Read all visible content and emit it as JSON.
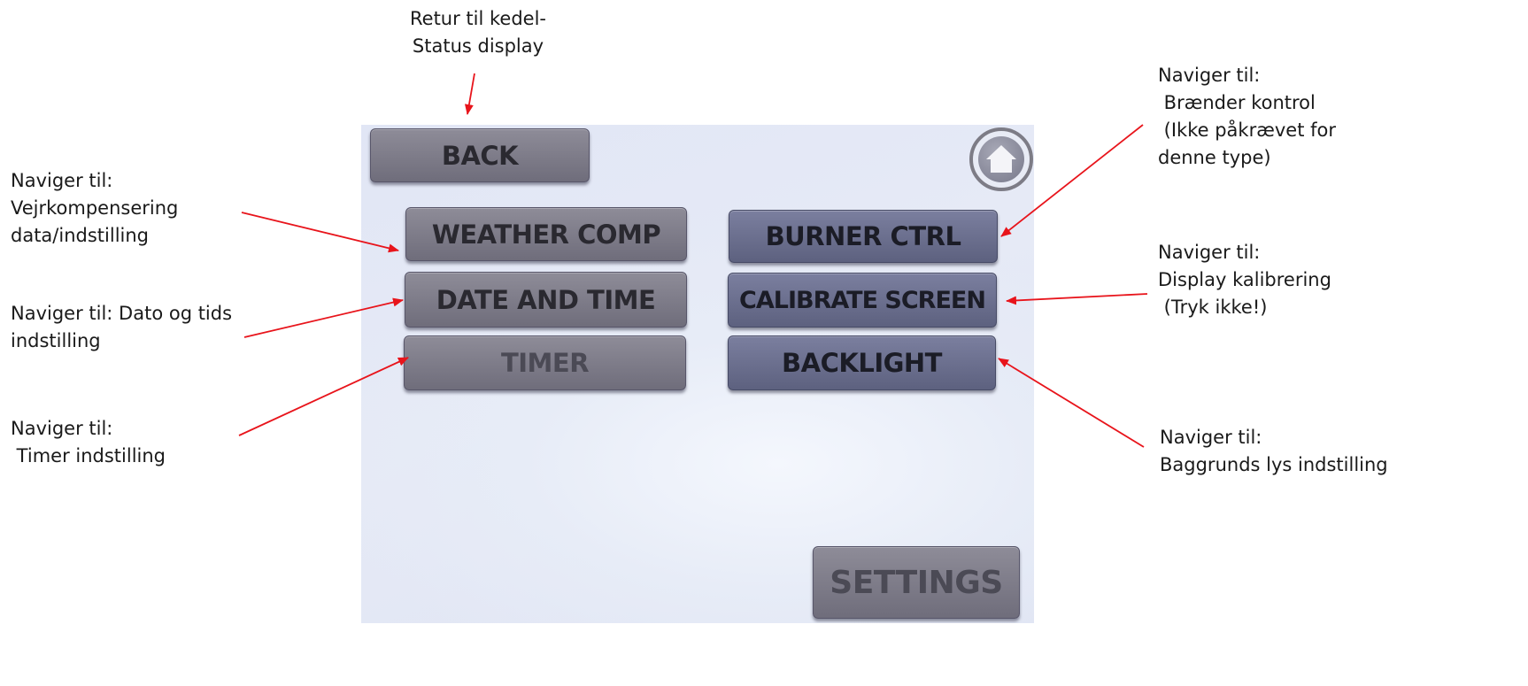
{
  "screen": {
    "back_label": "BACK",
    "home_icon": "home-icon",
    "buttons": {
      "weather_comp": "WEATHER COMP",
      "burner_ctrl": "BURNER CTRL",
      "date_and_time": "DATE AND TIME",
      "calibrate_screen": "CALIBRATE SCREEN",
      "timer": "TIMER",
      "backlight": "BACKLIGHT",
      "settings": "SETTINGS"
    }
  },
  "annotations": {
    "back": [
      "Retur til kedel-",
      "Status display"
    ],
    "weather": [
      "Naviger til:",
      "Vejrkompensering",
      "data/indstilling"
    ],
    "date": [
      "Naviger til: Dato og tids",
      "indstilling"
    ],
    "timer": [
      "Naviger til:",
      " Timer indstilling"
    ],
    "burner": [
      "Naviger til:",
      " Brænder kontrol",
      " (Ikke påkrævet for",
      "denne type)"
    ],
    "calibrate": [
      "Naviger til:",
      "Display kalibrering",
      " (Tryk ikke!)"
    ],
    "backlight": [
      "Naviger til:",
      "Baggrunds lys indstilling"
    ]
  },
  "colors": {
    "arrow": "#e8141b",
    "button_gray": "#7f7d8a",
    "button_blue": "#6c7090",
    "screen_bg": "#e3e8f5"
  }
}
